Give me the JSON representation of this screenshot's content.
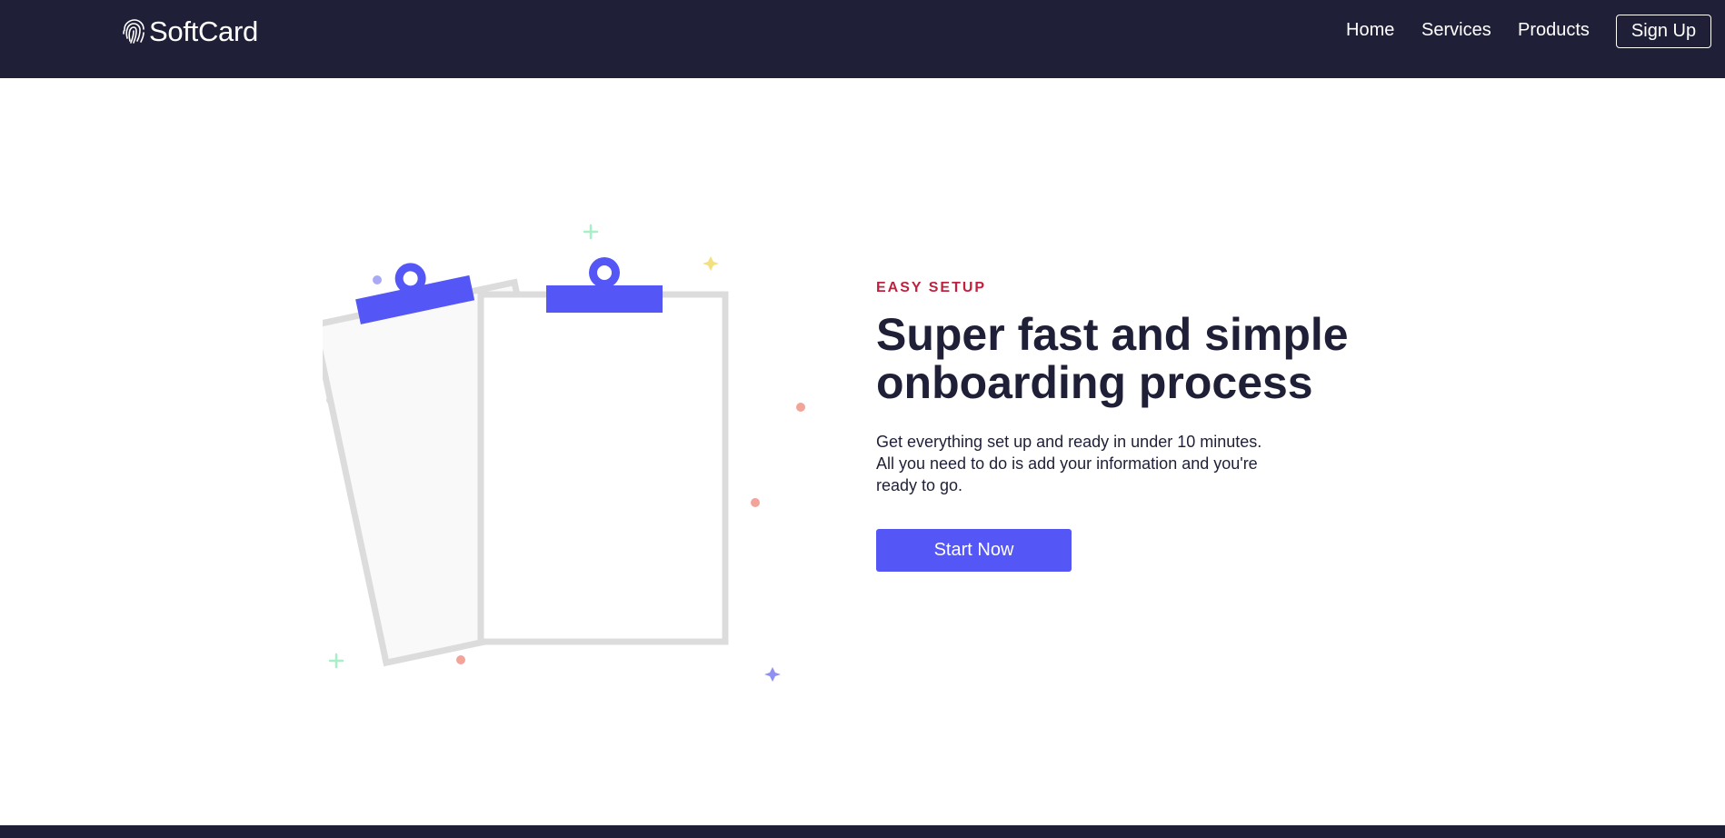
{
  "nav": {
    "logo_text": "SoftCard",
    "logo_icon": "fingerprint-icon",
    "links": [
      "Home",
      "Services",
      "Products"
    ],
    "signup_label": "Sign Up"
  },
  "hero": {
    "eyebrow": "EASY SETUP",
    "headline": "Super fast and simple onboarding process",
    "description": "Get everything set up and ready in under 10 minutes. All you need to do is add your information and you're ready to go.",
    "cta_label": "Start Now",
    "illustration": "clipboards-illustration"
  },
  "colors": {
    "nav_bg": "#1f2037",
    "accent": "#5456f5",
    "eyebrow": "#c0213f",
    "text": "#1f2037"
  }
}
